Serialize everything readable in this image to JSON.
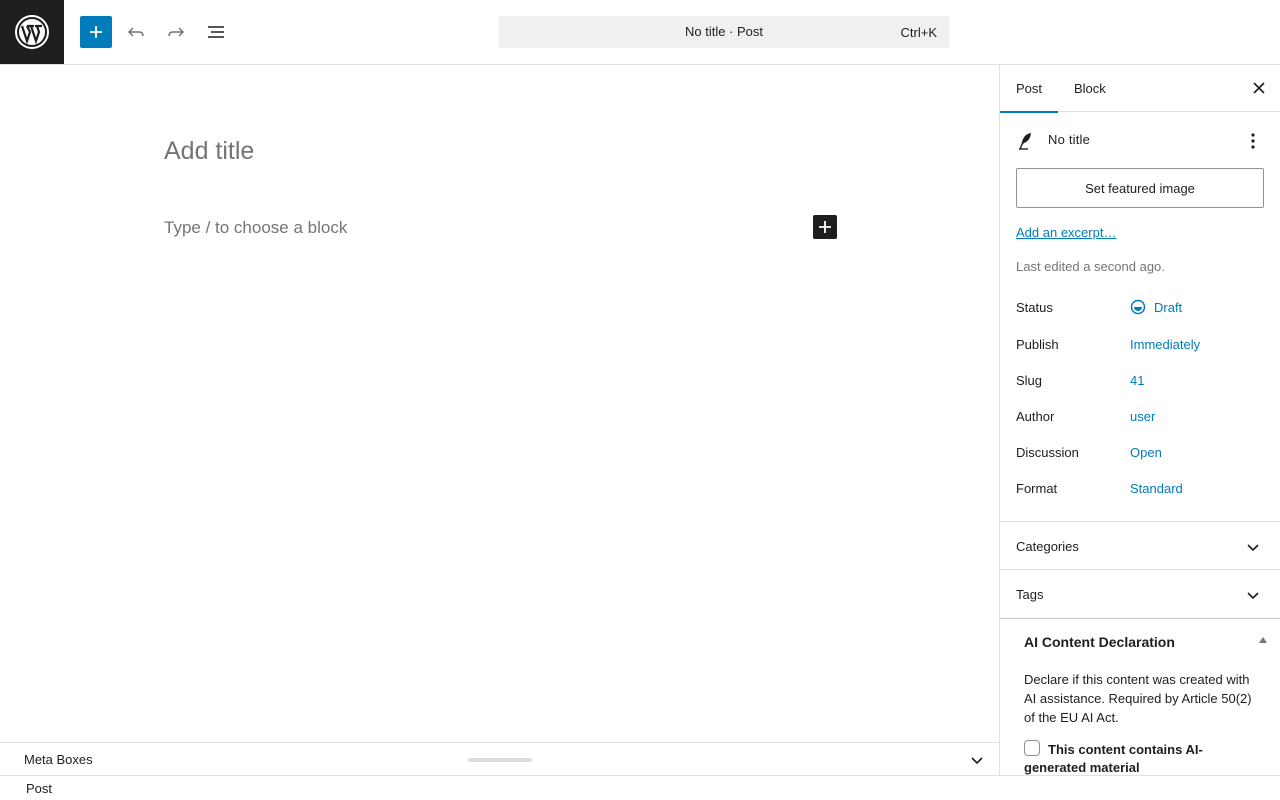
{
  "toolbar": {
    "logo_icon": "wordpress-logo",
    "command_title": "No title · Post",
    "command_shortcut": "Ctrl+K",
    "accent": "#007cba"
  },
  "editor": {
    "title_placeholder": "Add title",
    "block_placeholder": "Type / to choose a block"
  },
  "metaboxes": {
    "label": "Meta Boxes"
  },
  "footer": {
    "breadcrumb": "Post"
  },
  "sidebar": {
    "tabs": [
      {
        "label": "Post",
        "active": true
      },
      {
        "label": "Block",
        "active": false
      }
    ],
    "summary": {
      "title": "No title",
      "featured_image_label": "Set featured image",
      "excerpt_link": "Add an excerpt…",
      "last_edited": "Last edited a second ago."
    },
    "properties": [
      {
        "label": "Status",
        "value": "Draft"
      },
      {
        "label": "Publish",
        "value": "Immediately"
      },
      {
        "label": "Slug",
        "value": "41"
      },
      {
        "label": "Author",
        "value": "user"
      },
      {
        "label": "Discussion",
        "value": "Open"
      },
      {
        "label": "Format",
        "value": "Standard"
      }
    ],
    "panels": [
      {
        "label": "Categories"
      },
      {
        "label": "Tags"
      }
    ],
    "ai_declaration": {
      "title": "AI Content Declaration",
      "description": "Declare if this content was created with AI assistance. Required by Article 50(2) of the EU AI Act.",
      "checkbox_label": "This content contains AI-generated material",
      "checked": false
    }
  }
}
